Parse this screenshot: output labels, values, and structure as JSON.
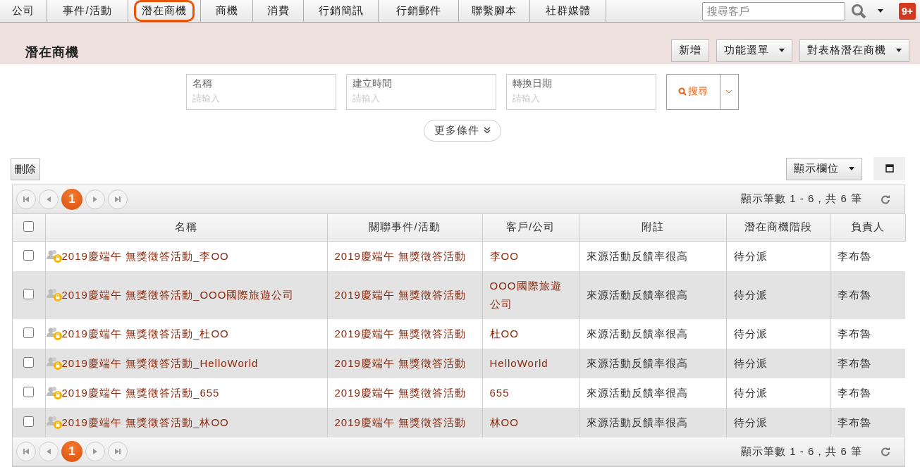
{
  "nav": {
    "tabs": [
      {
        "label": "公司",
        "selected": false
      },
      {
        "label": "事件/活動",
        "selected": false
      },
      {
        "label": "潛在商機",
        "selected": true
      },
      {
        "label": "商機",
        "selected": false
      },
      {
        "label": "消費",
        "selected": false
      },
      {
        "label": "行銷簡訊",
        "selected": false
      },
      {
        "label": "行銷郵件",
        "selected": false
      },
      {
        "label": "聯繫腳本",
        "selected": false
      },
      {
        "label": "社群媒體",
        "selected": false
      }
    ],
    "search": {
      "placeholder": "搜尋客戶"
    },
    "notifications": "9+"
  },
  "header": {
    "title": "潛在商機",
    "buttons": [
      {
        "label": "新增",
        "kind": "plain"
      },
      {
        "label": "功能選單",
        "kind": "menu"
      },
      {
        "label": "對表格潛在商機",
        "kind": "menu"
      }
    ]
  },
  "filters": [
    {
      "label": "名稱",
      "placeholder": "請輸入"
    },
    {
      "label": "建立時間",
      "placeholder": "請輸入"
    },
    {
      "label": "轉換日期",
      "placeholder": "請輸入"
    }
  ],
  "search_button": "搜尋",
  "more_conditions": "更多條件",
  "toolbar": {
    "delete": "刪除",
    "columns_button": "顯示欄位"
  },
  "table": {
    "pager_top": {
      "current": "1",
      "summary": "顯示筆數 1 - 6，共 6 筆"
    },
    "select_all": {
      "checked": false
    },
    "columns": [
      "名稱",
      "關聯事件/活動",
      "客戶/公司",
      "附註",
      "潛在商機階段",
      "負責人"
    ],
    "rows": [
      {
        "checked": false,
        "cells": [
          "2019慶端午 無獎徵答活動_李OO",
          "2019慶端午 無獎徵答活動",
          "李OO",
          "來源活動反饋率很高",
          "待分派",
          "李布魯"
        ]
      },
      {
        "checked": false,
        "cells": [
          "2019慶端午 無獎徵答活動_OOO國際旅遊公司",
          "2019慶端午 無獎徵答活動",
          "OOO國際旅遊公司",
          "來源活動反饋率很高",
          "待分派",
          "李布魯"
        ]
      },
      {
        "checked": false,
        "cells": [
          "2019慶端午 無獎徵答活動_杜OO",
          "2019慶端午 無獎徵答活動",
          "杜OO",
          "來源活動反饋率很高",
          "待分派",
          "李布魯"
        ]
      },
      {
        "checked": false,
        "cells": [
          "2019慶端午 無獎徵答活動_HelloWorld",
          "2019慶端午 無獎徵答活動",
          "HelloWorld",
          "來源活動反饋率很高",
          "待分派",
          "李布魯"
        ]
      },
      {
        "checked": false,
        "cells": [
          "2019慶端午 無獎徵答活動_655",
          "2019慶端午 無獎徵答活動",
          "655",
          "來源活動反饋率很高",
          "待分派",
          "李布魯"
        ]
      },
      {
        "checked": false,
        "cells": [
          "2019慶端午 無獎徵答活動_林OO",
          "2019慶端午 無獎徵答活動",
          "林OO",
          "來源活動反饋率很高",
          "待分派",
          "李布魯"
        ]
      }
    ],
    "pager_bottom": {
      "current": "1",
      "summary": "顯示筆數 1 - 6，共 6 筆"
    }
  }
}
